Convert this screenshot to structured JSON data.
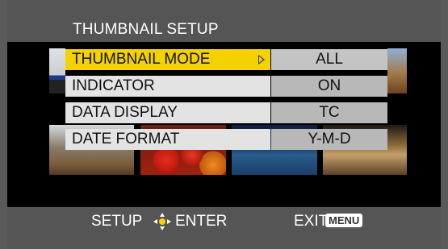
{
  "header": {
    "title": "THUMBNAIL SETUP"
  },
  "menu": {
    "items": [
      {
        "label": "THUMBNAIL MODE",
        "value": "ALL",
        "selected": true
      },
      {
        "label": "INDICATOR",
        "value": "ON",
        "selected": false
      },
      {
        "label": "DATA DISPLAY",
        "value": "TC",
        "selected": false
      },
      {
        "label": "DATE FORMAT",
        "value": "Y-M-D",
        "selected": false
      }
    ]
  },
  "footer": {
    "setup_label": "SETUP",
    "joystick_icon": "joystick-icon",
    "enter_label": "ENTER",
    "exit_label": "EXIT",
    "menu_button_label": "MENU"
  },
  "colors": {
    "selected_row": "#f4d100",
    "row_bg": "#e3e3e3",
    "value_bg": "#b8b8b8",
    "header_bg": "#555555"
  }
}
